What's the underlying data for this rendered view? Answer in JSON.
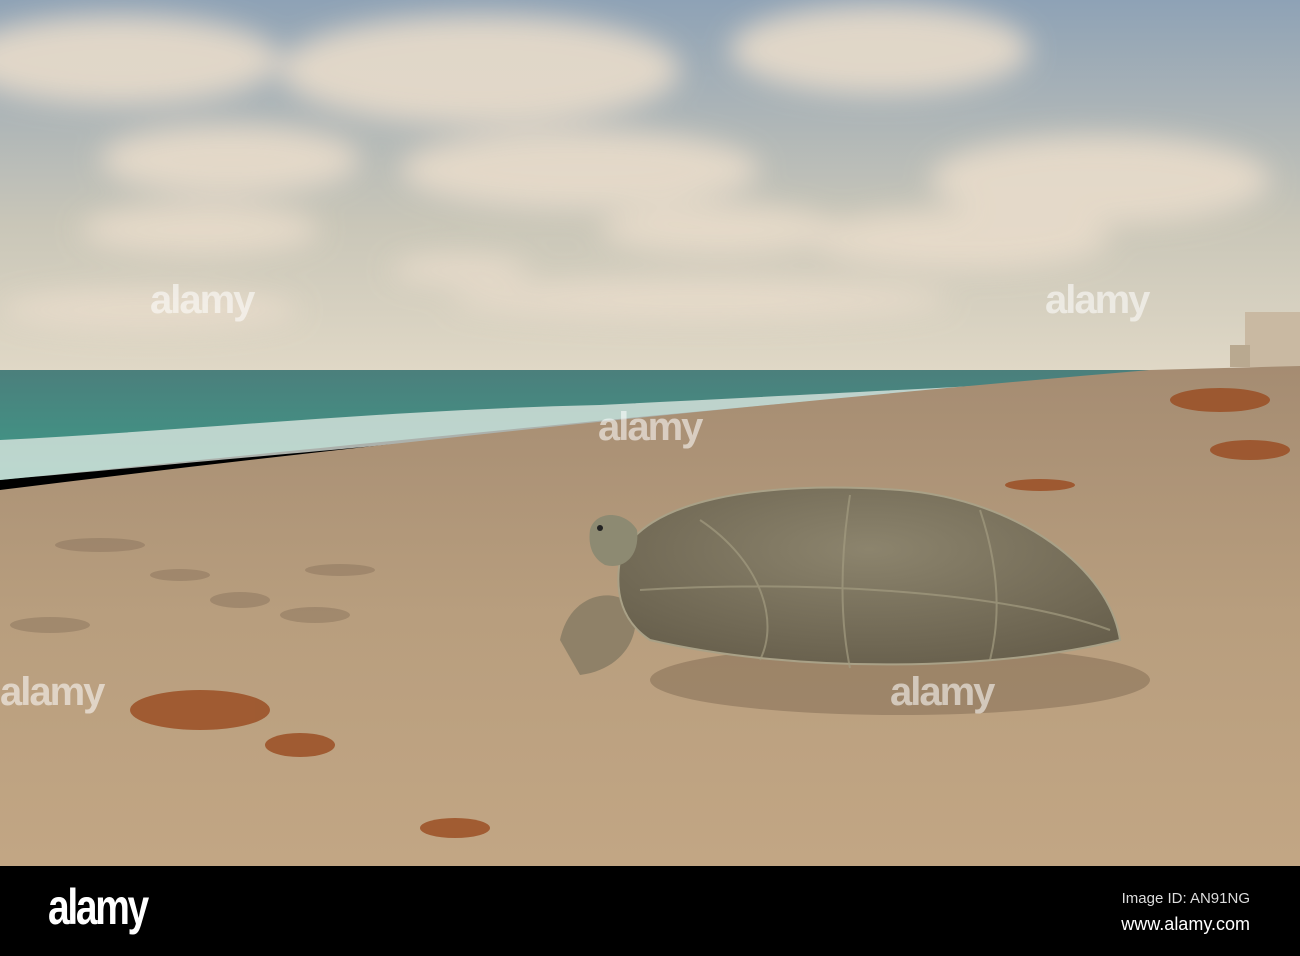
{
  "photo": {
    "subject": "sea-turtle-on-beach",
    "colors": {
      "sky_top": "#8fa3b8",
      "sky_horizon": "#d6d2c4",
      "sea": "#3f8a80",
      "sand": "#b39a7a",
      "shell": "#7d7560"
    }
  },
  "watermark": {
    "logo_text": "alamy"
  },
  "footer": {
    "logo": "alamy",
    "image_id": "Image ID: AN91NG",
    "url": "www.alamy.com"
  }
}
